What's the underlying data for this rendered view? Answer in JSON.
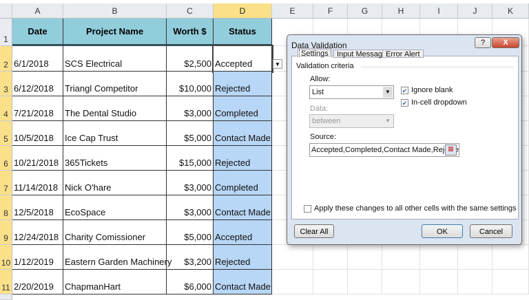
{
  "columns": [
    "A",
    "B",
    "C",
    "D",
    "E",
    "F",
    "G",
    "H",
    "I",
    "J",
    "K"
  ],
  "rows": [
    "1",
    "2",
    "3",
    "4",
    "5",
    "6",
    "7",
    "8",
    "9",
    "10",
    "11"
  ],
  "headers": [
    "Date",
    "Project Name",
    "Worth $",
    "Status"
  ],
  "data": [
    [
      "6/1/2018",
      "SCS Electrical",
      "$2,500",
      "Accepted"
    ],
    [
      "6/12/2018",
      "Triangl Competitor",
      "$10,000",
      "Rejected"
    ],
    [
      "7/21/2018",
      "The Dental Studio",
      "$3,000",
      "Completed"
    ],
    [
      "10/5/2018",
      "Ice Cap Trust",
      "$5,000",
      "Contact Made"
    ],
    [
      "10/21/2018",
      "365Tickets",
      "$15,000",
      "Rejected"
    ],
    [
      "11/14/2018",
      "Nick O'hare",
      "$3,000",
      "Completed"
    ],
    [
      "12/5/2018",
      "EcoSpace",
      "$3,000",
      "Contact Made"
    ],
    [
      "12/24/2018",
      "Charity Comissioner",
      "$5,000",
      "Accepted"
    ],
    [
      "1/12/2019",
      "Eastern Garden Machinery",
      "$3,200",
      "Rejected"
    ],
    [
      "2/20/2019",
      "ChapmanHart",
      "$6,000",
      "Contact Made"
    ]
  ],
  "dialog": {
    "title": "Data Validation",
    "help": "?",
    "close": "X",
    "tabs": [
      "Settings",
      "Input Message",
      "Error Alert"
    ],
    "section": "Validation criteria",
    "allow_label": "Allow:",
    "allow_value": "List",
    "data_label": "Data:",
    "data_value": "between",
    "ignore_blank": "Ignore blank",
    "ignore_blank_checked": true,
    "in_cell": "In-cell dropdown",
    "in_cell_checked": true,
    "source_label": "Source:",
    "source_value": "Accepted,Completed,Contact Made,Rejected",
    "apply_all": "Apply these changes to all other cells with the same settings",
    "apply_all_checked": false,
    "clear_all": "Clear All",
    "ok": "OK",
    "cancel": "Cancel"
  }
}
